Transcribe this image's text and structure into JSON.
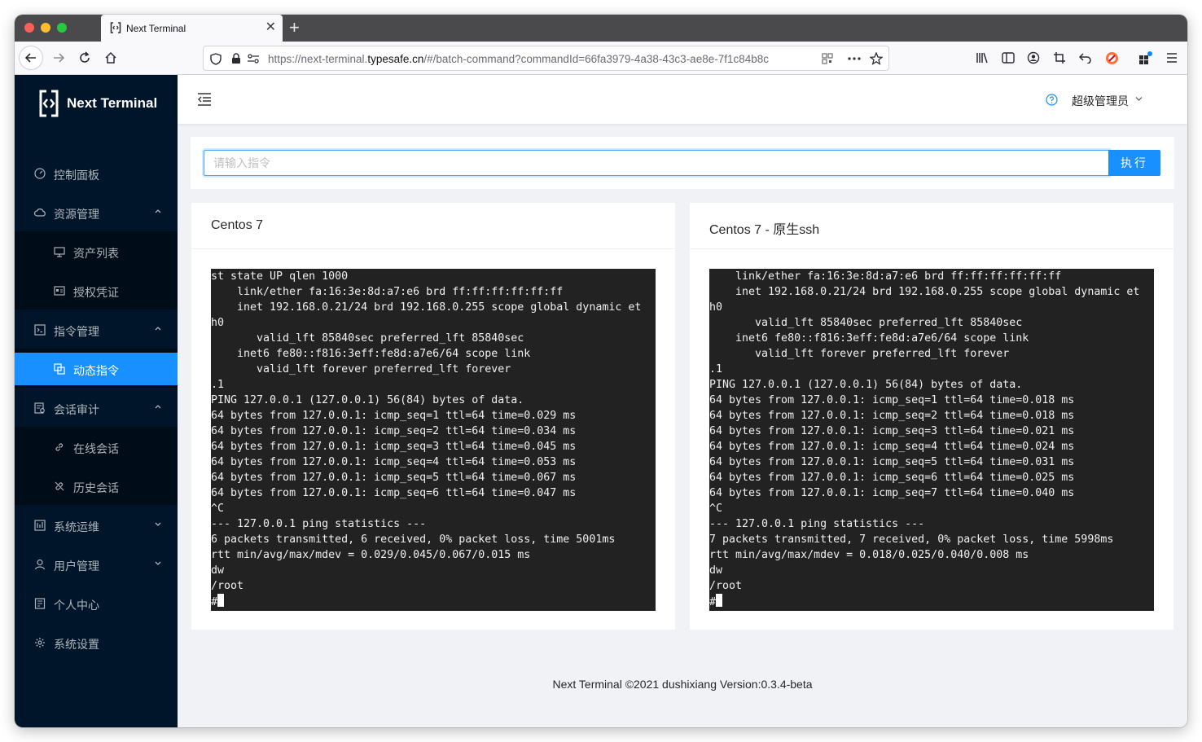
{
  "browser": {
    "tab_title": "Next Terminal",
    "url_prefix": "https://next-terminal.",
    "url_domain": "typesafe.cn",
    "url_path": "/#/batch-command?commandId=66fa3979-4a38-43c3-ae8e-7f1c84b8c"
  },
  "app": {
    "name": "Next Terminal",
    "user": "超级管理员"
  },
  "sidebar": {
    "items": [
      {
        "label": "控制面板",
        "icon": "dashboard-icon"
      },
      {
        "label": "资源管理",
        "icon": "cloud-icon"
      },
      {
        "label": "资产列表",
        "icon": "desktop-icon"
      },
      {
        "label": "授权凭证",
        "icon": "idcard-icon"
      },
      {
        "label": "指令管理",
        "icon": "code-icon"
      },
      {
        "label": "动态指令",
        "icon": "block-icon"
      },
      {
        "label": "会话审计",
        "icon": "audit-icon"
      },
      {
        "label": "在线会话",
        "icon": "link-icon"
      },
      {
        "label": "历史会话",
        "icon": "disconnect-icon"
      },
      {
        "label": "系统运维",
        "icon": "control-icon"
      },
      {
        "label": "用户管理",
        "icon": "user-icon"
      },
      {
        "label": "个人中心",
        "icon": "profile-icon"
      },
      {
        "label": "系统设置",
        "icon": "setting-icon"
      }
    ]
  },
  "command": {
    "placeholder": "请输入指令",
    "button_label": "执行"
  },
  "terminals": [
    {
      "title": "Centos 7",
      "lines": [
        "st state UP qlen 1000",
        "    link/ether fa:16:3e:8d:a7:e6 brd ff:ff:ff:ff:ff:ff",
        "    inet 192.168.0.21/24 brd 192.168.0.255 scope global dynamic et",
        "h0",
        "       valid_lft 85840sec preferred_lft 85840sec",
        "    inet6 fe80::f816:3eff:fe8d:a7e6/64 scope link",
        "       valid_lft forever preferred_lft forever",
        ".1",
        "PING 127.0.0.1 (127.0.0.1) 56(84) bytes of data.",
        "64 bytes from 127.0.0.1: icmp_seq=1 ttl=64 time=0.029 ms",
        "64 bytes from 127.0.0.1: icmp_seq=2 ttl=64 time=0.034 ms",
        "64 bytes from 127.0.0.1: icmp_seq=3 ttl=64 time=0.045 ms",
        "64 bytes from 127.0.0.1: icmp_seq=4 ttl=64 time=0.053 ms",
        "64 bytes from 127.0.0.1: icmp_seq=5 ttl=64 time=0.067 ms",
        "64 bytes from 127.0.0.1: icmp_seq=6 ttl=64 time=0.047 ms",
        "^C",
        "--- 127.0.0.1 ping statistics ---",
        "6 packets transmitted, 6 received, 0% packet loss, time 5001ms",
        "rtt min/avg/max/mdev = 0.029/0.045/0.067/0.015 ms",
        "dw",
        "/root",
        "#"
      ]
    },
    {
      "title": "Centos 7 - 原生ssh",
      "lines": [
        "    link/ether fa:16:3e:8d:a7:e6 brd ff:ff:ff:ff:ff:ff",
        "    inet 192.168.0.21/24 brd 192.168.0.255 scope global dynamic et",
        "h0",
        "       valid_lft 85840sec preferred_lft 85840sec",
        "    inet6 fe80::f816:3eff:fe8d:a7e6/64 scope link",
        "       valid_lft forever preferred_lft forever",
        ".1",
        "PING 127.0.0.1 (127.0.0.1) 56(84) bytes of data.",
        "64 bytes from 127.0.0.1: icmp_seq=1 ttl=64 time=0.018 ms",
        "64 bytes from 127.0.0.1: icmp_seq=2 ttl=64 time=0.018 ms",
        "64 bytes from 127.0.0.1: icmp_seq=3 ttl=64 time=0.021 ms",
        "64 bytes from 127.0.0.1: icmp_seq=4 ttl=64 time=0.024 ms",
        "64 bytes from 127.0.0.1: icmp_seq=5 ttl=64 time=0.031 ms",
        "64 bytes from 127.0.0.1: icmp_seq=6 ttl=64 time=0.025 ms",
        "64 bytes from 127.0.0.1: icmp_seq=7 ttl=64 time=0.040 ms",
        "^C",
        "--- 127.0.0.1 ping statistics ---",
        "7 packets transmitted, 7 received, 0% packet loss, time 5998ms",
        "rtt min/avg/max/mdev = 0.018/0.025/0.040/0.008 ms",
        "dw",
        "/root",
        "#"
      ]
    }
  ],
  "footer": {
    "text": "Next Terminal ©2021 dushixiang Version:0.3.4-beta"
  },
  "colors": {
    "sidebar_bg": "#001529",
    "submenu_bg": "#000c17",
    "accent": "#1890ff",
    "terminal_bg": "#222222"
  }
}
